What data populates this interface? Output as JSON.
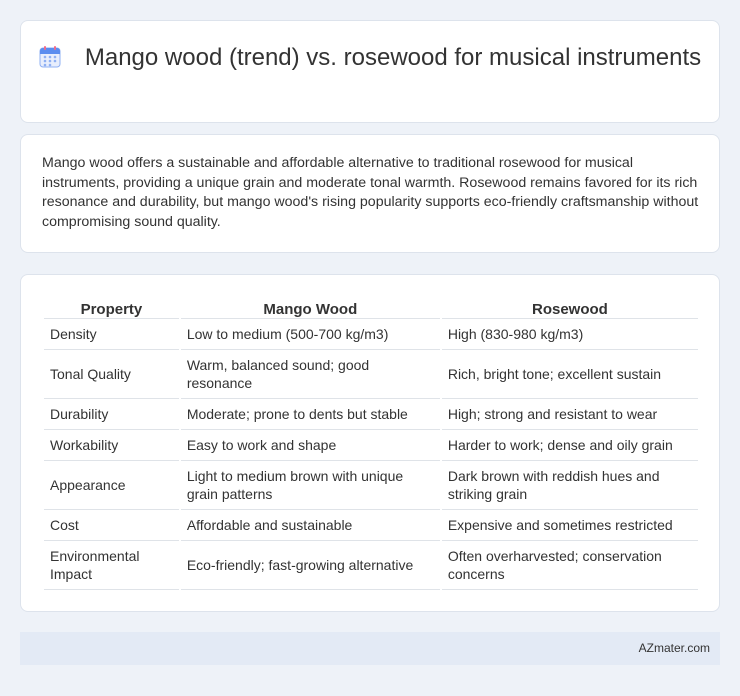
{
  "header": {
    "title": "Mango wood (trend) vs. rosewood for musical instruments",
    "icon": "calendar-icon"
  },
  "summary": {
    "text": "Mango wood offers a sustainable and affordable alternative to traditional rosewood for musical instruments, providing a unique grain and moderate tonal warmth. Rosewood remains favored for its rich resonance and durability, but mango wood's rising popularity supports eco-friendly craftsmanship without compromising sound quality."
  },
  "table": {
    "headers": [
      "Property",
      "Mango Wood",
      "Rosewood"
    ],
    "rows": [
      [
        "Density",
        "Low to medium (500-700 kg/m3)",
        "High (830-980 kg/m3)"
      ],
      [
        "Tonal Quality",
        "Warm, balanced sound; good resonance",
        "Rich, bright tone; excellent sustain"
      ],
      [
        "Durability",
        "Moderate; prone to dents but stable",
        "High; strong and resistant to wear"
      ],
      [
        "Workability",
        "Easy to work and shape",
        "Harder to work; dense and oily grain"
      ],
      [
        "Appearance",
        "Light to medium brown with unique grain patterns",
        "Dark brown with reddish hues and striking grain"
      ],
      [
        "Cost",
        "Affordable and sustainable",
        "Expensive and sometimes restricted"
      ],
      [
        "Environmental Impact",
        "Eco-friendly; fast-growing alternative",
        "Often overharvested; conservation concerns"
      ]
    ]
  },
  "footer": {
    "brand": "AZmater.com"
  },
  "colors": {
    "background": "#eef2f8",
    "card": "#ffffff",
    "footer": "#e3eaf5",
    "icon_blue": "#5b8def",
    "icon_pink": "#f26b8a"
  }
}
